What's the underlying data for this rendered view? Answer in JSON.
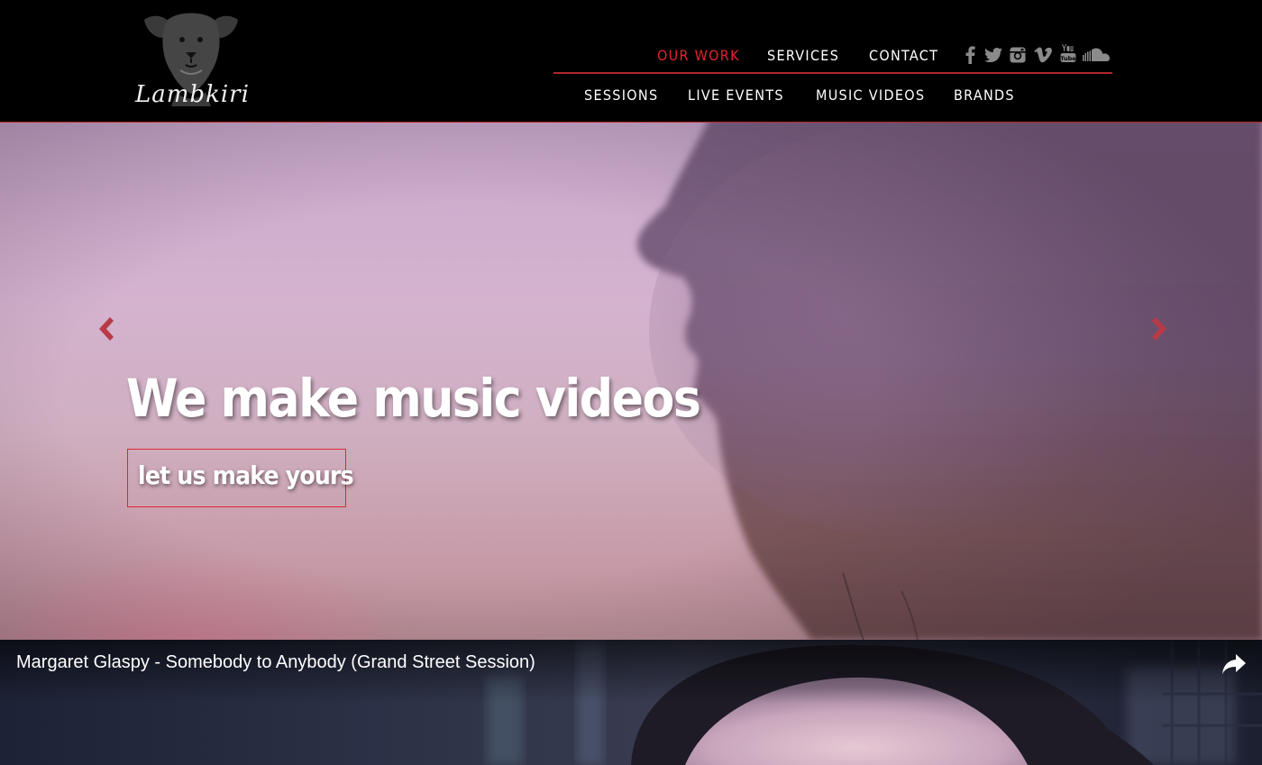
{
  "brand": {
    "logo_text": "Lambkiri"
  },
  "nav": {
    "primary": [
      {
        "label": "OUR WORK",
        "active": true
      },
      {
        "label": "SERVICES",
        "active": false
      },
      {
        "label": "CONTACT",
        "active": false
      }
    ],
    "secondary": [
      {
        "label": "SESSIONS"
      },
      {
        "label": "LIVE EVENTS"
      },
      {
        "label": "MUSIC VIDEOS"
      },
      {
        "label": "BRANDS"
      }
    ],
    "social_icons": [
      "facebook-icon",
      "twitter-icon",
      "instagram-icon",
      "vimeo-icon",
      "youtube-icon",
      "soundcloud-icon"
    ]
  },
  "hero": {
    "headline": "We make music videos",
    "cta": "let us make yours",
    "prev_icon": "chevron-left-icon",
    "next_icon": "chevron-right-icon"
  },
  "video": {
    "title": "Margaret Glaspy - Somebody to Anybody (Grand Street Session)",
    "share_icon": "share-icon"
  },
  "colors": {
    "accent": "#e0262f",
    "header_bg": "#000000",
    "nav_text": "#ffffff",
    "icon_gray": "#8a8a8a"
  }
}
